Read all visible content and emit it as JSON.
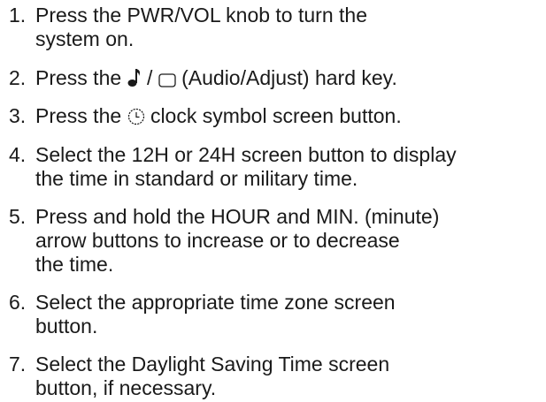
{
  "steps": [
    {
      "number": "1.",
      "lines": [
        "Press the PWR/VOL knob to turn the",
        "system on."
      ]
    },
    {
      "number": "2.",
      "before": "Press the",
      "sep": "/",
      "after": "(Audio/Adjust) hard key.",
      "icons": [
        "music-note-icon",
        "screen-rectangle-icon"
      ]
    },
    {
      "number": "3.",
      "before": "Press the",
      "after": "clock symbol screen button.",
      "icons": [
        "clock-icon"
      ]
    },
    {
      "number": "4.",
      "lines": [
        "Select the 12H or 24H screen button to display",
        "the time in standard or military time."
      ]
    },
    {
      "number": "5.",
      "lines": [
        "Press and hold the HOUR and MIN. (minute)",
        "arrow buttons to increase or to decrease",
        "the time."
      ]
    },
    {
      "number": "6.",
      "lines": [
        "Select the appropriate time zone screen",
        "button."
      ]
    },
    {
      "number": "7.",
      "lines": [
        "Select the Daylight Saving Time screen",
        "button, if necessary."
      ]
    }
  ]
}
